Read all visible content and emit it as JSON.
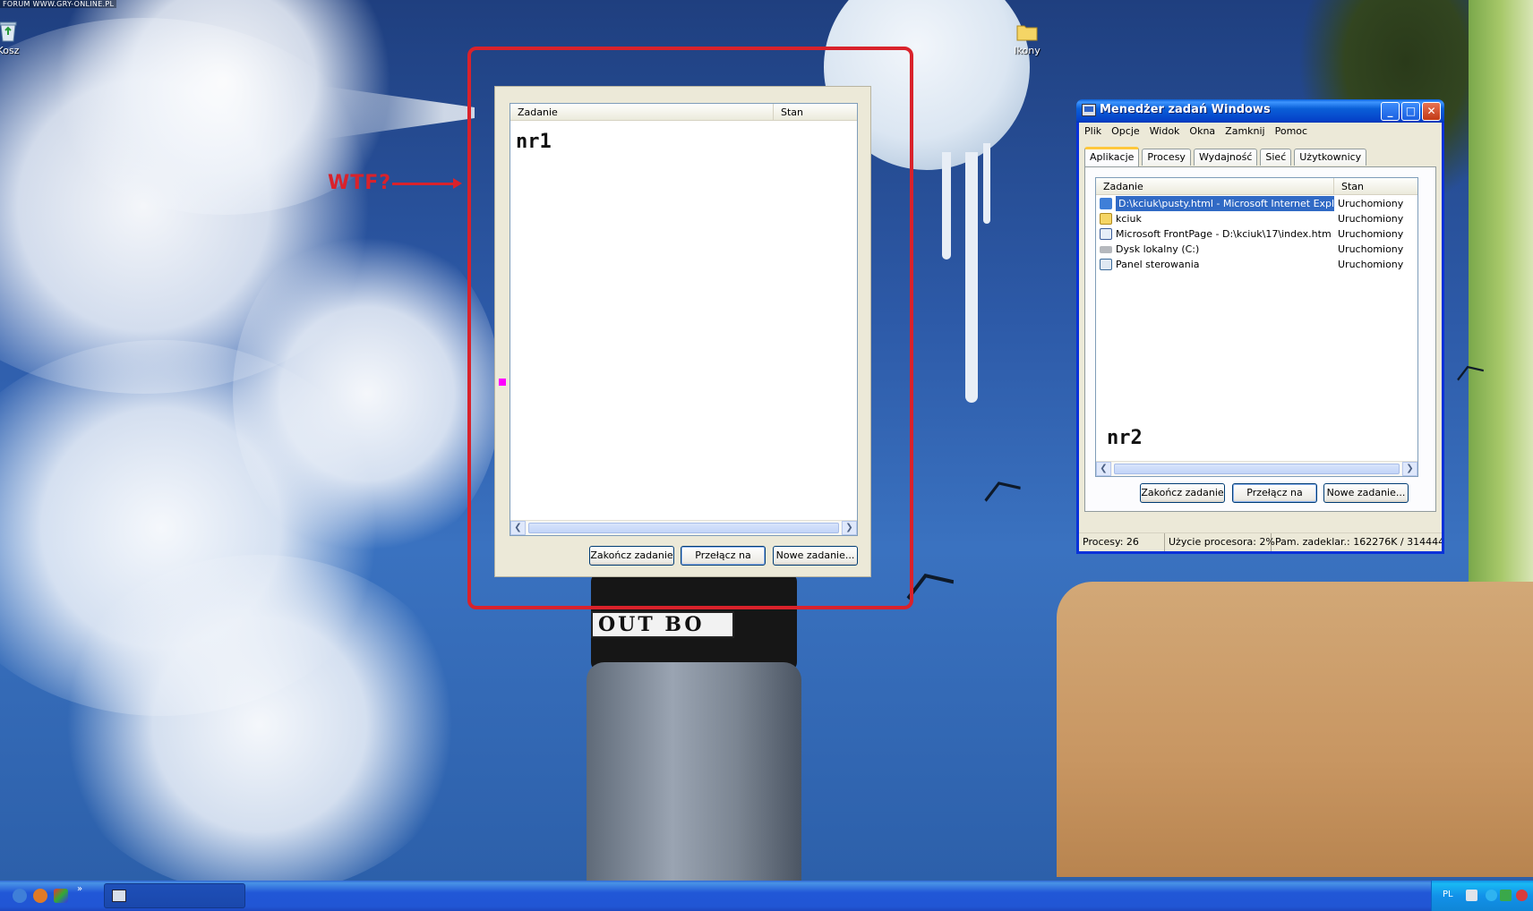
{
  "desktop": {
    "forum_tag": "FORUM WWW.GRY-ONLINE.PL",
    "icons": [
      {
        "label": "Kosz",
        "icon": "recycle-bin-icon"
      },
      {
        "label": "Ikony",
        "icon": "folder-icon"
      }
    ],
    "wallpaper_text": "OUT BO",
    "annotation": {
      "text": "WTF?",
      "color": "#d9222b",
      "frame_color": "#d9222b"
    }
  },
  "window_nr1": {
    "columns": [
      "Zadanie",
      "Stan"
    ],
    "label": "nr1",
    "buttons": {
      "end_task": "Zakończ zadanie",
      "switch_to": "Przełącz na",
      "new_task": "Nowe zadanie..."
    }
  },
  "task_manager": {
    "title": "Menedżer zadań Windows",
    "menu": [
      "Plik",
      "Opcje",
      "Widok",
      "Okna",
      "Zamknij",
      "Pomoc"
    ],
    "tabs": [
      "Aplikacje",
      "Procesy",
      "Wydajność",
      "Sieć",
      "Użytkownicy"
    ],
    "active_tab": "Aplikacje",
    "columns": [
      "Zadanie",
      "Stan"
    ],
    "rows": [
      {
        "name": "D:\\kciuk\\pusty.html - Microsoft Internet Explorer",
        "state": "Uruchomiony",
        "icon": "internet-explorer-icon",
        "selected": true
      },
      {
        "name": "kciuk",
        "state": "Uruchomiony",
        "icon": "folder-icon",
        "selected": false
      },
      {
        "name": "Microsoft FrontPage - D:\\kciuk\\17\\index.htm",
        "state": "Uruchomiony",
        "icon": "frontpage-icon",
        "selected": false
      },
      {
        "name": "Dysk lokalny (C:)",
        "state": "Uruchomiony",
        "icon": "drive-icon",
        "selected": false
      },
      {
        "name": "Panel sterowania",
        "state": "Uruchomiony",
        "icon": "control-panel-icon",
        "selected": false
      }
    ],
    "label": "nr2",
    "buttons": {
      "end_task": "Zakończ zadanie",
      "switch_to": "Przełącz na",
      "new_task": "Nowe zadanie..."
    },
    "status": {
      "processes": "Procesy: 26",
      "cpu": "Użycie procesora: 2%",
      "memory": "Pam. zadeklar.: 162276K / 314444"
    },
    "colors": {
      "titlebar": "#0a5fd8",
      "selection": "#316ac5"
    }
  },
  "taskbar": {
    "quicklaunch": [
      "internet-explorer-icon",
      "firefox-icon",
      "paint-icon"
    ],
    "task_button_icon": "task-manager-icon",
    "tray": {
      "language": "PL"
    }
  }
}
